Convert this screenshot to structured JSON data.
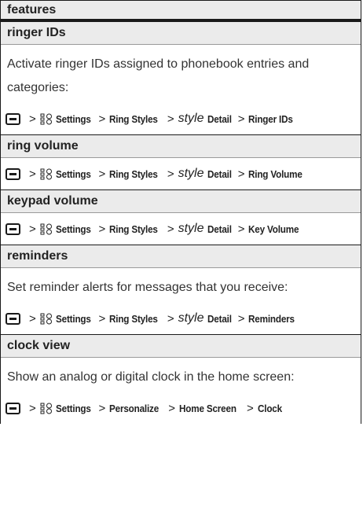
{
  "header": {
    "title": "features"
  },
  "icons": {
    "menu_key": "menu-key-icon",
    "settings": "settings-icon"
  },
  "features": [
    {
      "title": "ringer IDs",
      "desc": "Activate ringer IDs assigned to phonebook entries and categories:",
      "path": [
        "Settings",
        "Ring Styles",
        "style",
        "Detail",
        "Ringer IDs"
      ]
    },
    {
      "title": "ring volume",
      "desc": "",
      "path": [
        "Settings",
        "Ring Styles",
        "style",
        "Detail",
        "Ring Volume"
      ]
    },
    {
      "title": "keypad volume",
      "desc": "",
      "path": [
        "Settings",
        "Ring Styles",
        "style",
        "Detail",
        "Key Volume"
      ]
    },
    {
      "title": "reminders",
      "desc": "Set reminder alerts for messages that you receive:",
      "path": [
        "Settings",
        "Ring Styles",
        "style",
        "Detail",
        "Reminders"
      ]
    },
    {
      "title": "clock view",
      "desc": "Show an analog or digital clock in the home screen:",
      "path": [
        "Settings",
        "Personalize",
        "Home Screen",
        "Clock"
      ]
    }
  ],
  "separator": ">"
}
